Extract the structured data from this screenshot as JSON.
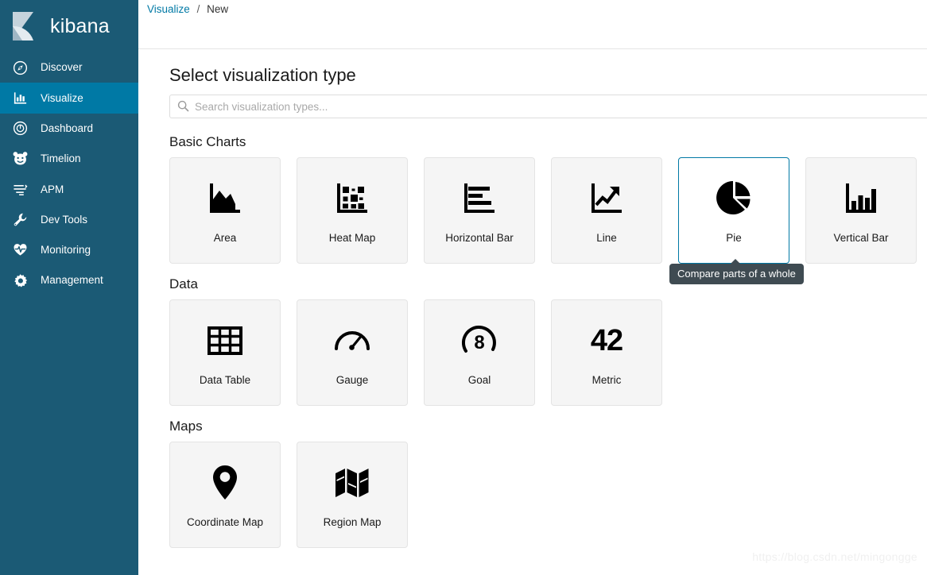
{
  "app": {
    "brand": "kibana",
    "brand_icon": "kibana-logo-icon",
    "sidebar_bg": "#1b5a75",
    "sidebar_active_bg": "#0079a5",
    "accent": "#0079a5"
  },
  "sidebar": {
    "items": [
      {
        "label": "Discover",
        "icon": "compass-icon",
        "active": false
      },
      {
        "label": "Visualize",
        "icon": "bar-chart-icon",
        "active": true
      },
      {
        "label": "Dashboard",
        "icon": "dashboard-icon",
        "active": false
      },
      {
        "label": "Timelion",
        "icon": "timelion-icon",
        "active": false
      },
      {
        "label": "APM",
        "icon": "apm-icon",
        "active": false
      },
      {
        "label": "Dev Tools",
        "icon": "wrench-icon",
        "active": false
      },
      {
        "label": "Monitoring",
        "icon": "heart-pulse-icon",
        "active": false
      },
      {
        "label": "Management",
        "icon": "gear-icon",
        "active": false
      }
    ]
  },
  "breadcrumb": {
    "parent": "Visualize",
    "separator": "/",
    "current": "New"
  },
  "main": {
    "page_title": "Select visualization type",
    "search": {
      "placeholder": "Search visualization types...",
      "value": "",
      "icon": "search-icon"
    },
    "sections": [
      {
        "title": "Basic Charts",
        "cards": [
          {
            "label": "Area",
            "icon": "area-chart-icon",
            "selected": false
          },
          {
            "label": "Heat Map",
            "icon": "heat-map-icon",
            "selected": false
          },
          {
            "label": "Horizontal Bar",
            "icon": "horizontal-bar-icon",
            "selected": false
          },
          {
            "label": "Line",
            "icon": "line-chart-icon",
            "selected": false
          },
          {
            "label": "Pie",
            "icon": "pie-chart-icon",
            "selected": true
          },
          {
            "label": "Vertical Bar",
            "icon": "vertical-bar-icon",
            "selected": false
          }
        ]
      },
      {
        "title": "Data",
        "cards": [
          {
            "label": "Data Table",
            "icon": "table-icon",
            "selected": false
          },
          {
            "label": "Gauge",
            "icon": "gauge-icon",
            "selected": false
          },
          {
            "label": "Goal",
            "icon": "goal-icon",
            "selected": false,
            "glyph": "8"
          },
          {
            "label": "Metric",
            "icon": "metric-icon",
            "selected": false,
            "glyph": "42"
          }
        ]
      },
      {
        "title": "Maps",
        "cards": [
          {
            "label": "Coordinate Map",
            "icon": "map-marker-icon",
            "selected": false
          },
          {
            "label": "Region Map",
            "icon": "folded-map-icon",
            "selected": false
          }
        ]
      }
    ]
  },
  "tooltip": {
    "text": "Compare parts of a whole",
    "bg": "#3f4b52"
  },
  "watermark": {
    "text": "https://blog.csdn.net/mingongge"
  }
}
